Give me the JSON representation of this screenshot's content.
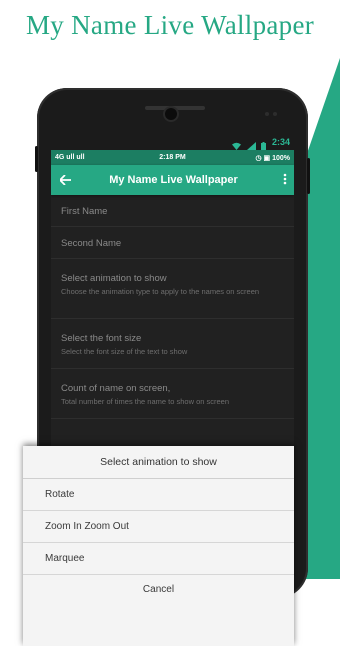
{
  "promo": {
    "title": "My Name Live Wallpaper"
  },
  "device_status": {
    "time": "2:34"
  },
  "status_bar": {
    "left": "4G ull ull",
    "time": "2:18 PM",
    "right": "◷ ▣ 100%"
  },
  "app_bar": {
    "back_icon": "arrow-left-icon",
    "title": "My Name Live Wallpaper",
    "overflow_icon": "more-vert-icon"
  },
  "preferences": [
    {
      "title": "First Name",
      "summary": ""
    },
    {
      "title": "Second Name",
      "summary": ""
    },
    {
      "title": "Select animation to show",
      "summary": "Choose the animation type to apply to the names on screen"
    },
    {
      "title": "Select the font size",
      "summary": "Select the font size of the text to show"
    },
    {
      "title": "Count of name on screen,",
      "summary": "Total number of times the name to show on screen"
    }
  ],
  "dialog": {
    "title": "Select animation to show",
    "options": [
      "Rotate",
      "Zoom In Zoom Out",
      "Marquee"
    ],
    "cancel_label": "Cancel"
  },
  "colors": {
    "accent": "#26a884",
    "status_bar": "#1c7e62",
    "screen_bg": "#212121",
    "dialog_bg": "#f4f4f4"
  }
}
